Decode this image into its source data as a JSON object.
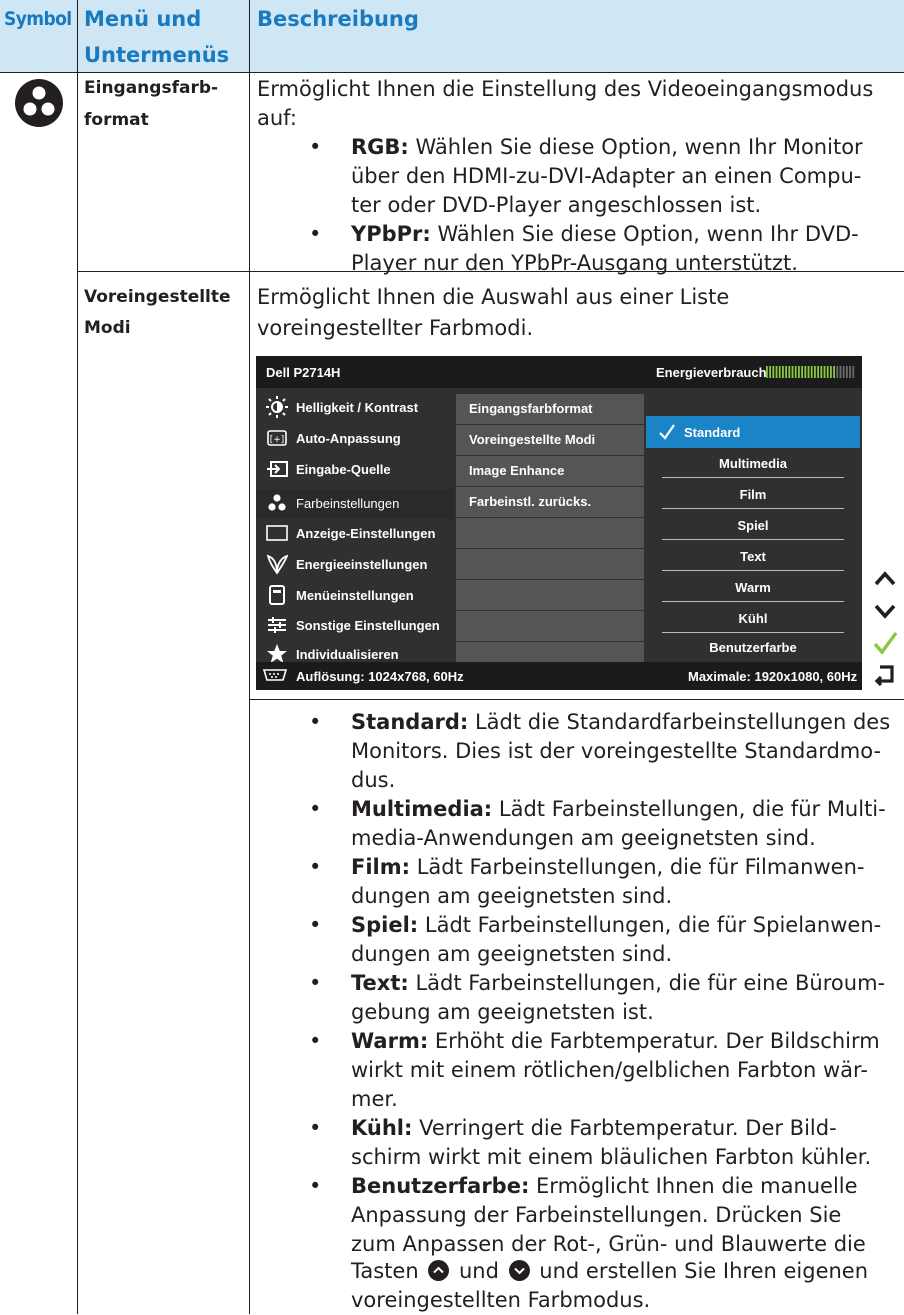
{
  "header": {
    "symbol": "Symbol",
    "menu_line1": "Menü und",
    "menu_line2": "Untermenüs",
    "desc": "Beschreibung"
  },
  "symbol_icon": "color-settings-icon",
  "row1": {
    "menu_line1": "Eingangsfarb-",
    "menu_line2": "format",
    "desc_line1": "Ermöglicht Ihnen die Einstellung des Videoeingangsmodus",
    "desc_line2": "auf:",
    "bullets": [
      {
        "bold": "RGB:",
        "lines": [
          " Wählen Sie diese Option, wenn Ihr Monitor",
          "über den HDMI-zu-DVI-Adapter an einen Compu-",
          "ter oder DVD-Player angeschlossen ist."
        ]
      },
      {
        "bold": "YPbPr:",
        "lines": [
          " Wählen Sie diese Option, wenn Ihr DVD-",
          "Player nur den YPbPr-Ausgang unterstützt."
        ]
      }
    ]
  },
  "row2": {
    "menu_line1": "Voreingestellte",
    "menu_line2": "Modi",
    "desc_line1": "Ermöglicht Ihnen die Auswahl aus einer Liste",
    "desc_line2": "voreingestellter Farbmodi."
  },
  "osd": {
    "model": "Dell P2714H",
    "energy_label": "Energieverbrauch",
    "main_items": [
      {
        "label": "Helligkeit / Kontrast",
        "icon": "brightness-icon"
      },
      {
        "label": "Auto-Anpassung",
        "icon": "auto-adjust-icon"
      },
      {
        "label": "Eingabe-Quelle",
        "icon": "input-source-icon"
      },
      {
        "label": "Farbeinstellungen",
        "icon": "color-settings-icon"
      },
      {
        "label": "Anzeige-Einstellungen",
        "icon": "display-settings-icon"
      },
      {
        "label": "Energieeinstellungen",
        "icon": "energy-icon"
      },
      {
        "label": "Menüeinstellungen",
        "icon": "menu-settings-icon"
      },
      {
        "label": "Sonstige Einstellungen",
        "icon": "other-settings-icon"
      },
      {
        "label": "Individualisieren",
        "icon": "star-icon"
      }
    ],
    "sub_items": [
      "Eingangsfarbformat",
      "Voreingestellte Modi",
      "Image Enhance",
      "Farbeinstl. zurücks."
    ],
    "options": [
      "Standard",
      "Multimedia",
      "Film",
      "Spiel",
      "Text",
      "Warm",
      "Kühl",
      "Benutzerfarbe"
    ],
    "selected_option": "Standard",
    "resolution": "Auflösung: 1024x768, 60Hz",
    "maximum": "Maximale: 1920x1080, 60Hz",
    "side_buttons": [
      "up-arrow-icon",
      "down-arrow-icon",
      "check-icon",
      "back-icon"
    ],
    "accent": "#1a84c7",
    "check_color": "#8dc63f"
  },
  "modes": [
    {
      "bold": "Standard:",
      "lines": [
        " Lädt die Standardfarbeinstellungen des",
        "Monitors. Dies ist der voreingestellte Standardmo-",
        "dus."
      ]
    },
    {
      "bold": "Multimedia:",
      "lines": [
        " Lädt Farbeinstellungen, die für Multi-",
        "media-Anwendungen am geeignetsten sind."
      ]
    },
    {
      "bold": "Film:",
      "lines": [
        " Lädt Farbeinstellungen, die für Filmanwen-",
        "dungen am geeignetsten sind."
      ]
    },
    {
      "bold": "Spiel:",
      "lines": [
        " Lädt Farbeinstellungen, die für Spielanwen-",
        "dungen am geeignetsten sind."
      ]
    },
    {
      "bold": "Text:",
      "lines": [
        " Lädt Farbeinstellungen, die für eine Büroum-",
        "gebung am geeignetsten ist."
      ]
    },
    {
      "bold": "Warm:",
      "lines": [
        " Erhöht die Farbtemperatur. Der Bildschirm",
        "wirkt mit einem rötlichen/gelblichen Farbton wär-",
        "mer."
      ]
    },
    {
      "bold": "Kühl:",
      "lines": [
        " Verringert die Farbtemperatur. Der Bild-",
        "schirm wirkt mit einem bläulichen Farbton kühler."
      ]
    },
    {
      "bold": "Benutzerfarbe:",
      "lines": [
        " Ermöglicht Ihnen die manuelle",
        "Anpassung der Farbeinstellungen. Drücken Sie",
        "zum Anpassen der Rot-, Grün- und Blauwerte die"
      ]
    }
  ],
  "tail": {
    "pre": "Tasten ",
    "mid": " und ",
    "post": "  und erstellen Sie Ihren eigenen",
    "last": "voreingestellten Farbmodus."
  },
  "colors": {
    "header_bg": "#cfe6f5",
    "header_text": "#1a7abf"
  }
}
